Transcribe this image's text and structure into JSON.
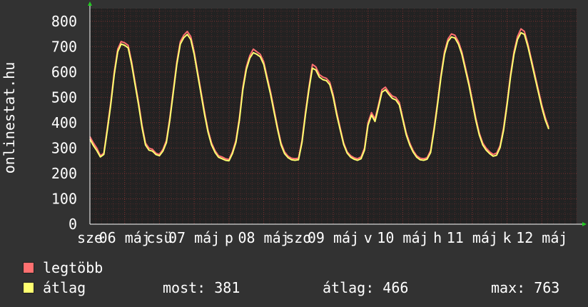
{
  "colors": {
    "background": "#323232",
    "plot_background": "#222222",
    "grid_major": "#7a3030",
    "grid_minor": "#4d2a2a",
    "text": "#ffffff",
    "max_series": "#ff7070",
    "avg_series": "#ffff70"
  },
  "chart_data": {
    "type": "line",
    "ylabel": "onlinestat.hu",
    "ylim": [
      0,
      850
    ],
    "yticks": [
      "0",
      "100",
      "200",
      "300",
      "400",
      "500",
      "600",
      "700",
      "800"
    ],
    "xlim": [
      0,
      7
    ],
    "xtick_labels": [
      {
        "x": 0.0,
        "label": "sze"
      },
      {
        "x": 0.5,
        "label": "06 máj"
      },
      {
        "x": 1.0,
        "label": "csü"
      },
      {
        "x": 1.5,
        "label": "07 máj"
      },
      {
        "x": 2.0,
        "label": "p"
      },
      {
        "x": 2.5,
        "label": "08 máj"
      },
      {
        "x": 3.0,
        "label": "szo"
      },
      {
        "x": 3.5,
        "label": "09 máj"
      },
      {
        "x": 4.0,
        "label": "v"
      },
      {
        "x": 4.5,
        "label": "10 máj"
      },
      {
        "x": 5.0,
        "label": "h"
      },
      {
        "x": 5.5,
        "label": "11 máj"
      },
      {
        "x": 6.0,
        "label": "k"
      },
      {
        "x": 6.5,
        "label": "12 máj"
      }
    ],
    "grid": true,
    "series": [
      {
        "name": "legtöbb",
        "color": "#ff7070",
        "points": [
          [
            0.0,
            345
          ],
          [
            0.05,
            320
          ],
          [
            0.1,
            300
          ],
          [
            0.15,
            270
          ],
          [
            0.2,
            280
          ],
          [
            0.25,
            380
          ],
          [
            0.3,
            480
          ],
          [
            0.35,
            600
          ],
          [
            0.4,
            690
          ],
          [
            0.45,
            720
          ],
          [
            0.5,
            715
          ],
          [
            0.55,
            705
          ],
          [
            0.6,
            640
          ],
          [
            0.65,
            560
          ],
          [
            0.7,
            480
          ],
          [
            0.75,
            390
          ],
          [
            0.8,
            320
          ],
          [
            0.85,
            300
          ],
          [
            0.9,
            295
          ],
          [
            0.95,
            280
          ],
          [
            1.0,
            275
          ],
          [
            1.05,
            295
          ],
          [
            1.1,
            330
          ],
          [
            1.15,
            420
          ],
          [
            1.2,
            530
          ],
          [
            1.25,
            640
          ],
          [
            1.3,
            720
          ],
          [
            1.35,
            745
          ],
          [
            1.4,
            760
          ],
          [
            1.45,
            740
          ],
          [
            1.5,
            680
          ],
          [
            1.55,
            600
          ],
          [
            1.6,
            520
          ],
          [
            1.65,
            440
          ],
          [
            1.7,
            370
          ],
          [
            1.75,
            320
          ],
          [
            1.8,
            290
          ],
          [
            1.85,
            270
          ],
          [
            1.9,
            265
          ],
          [
            1.95,
            258
          ],
          [
            2.0,
            255
          ],
          [
            2.05,
            285
          ],
          [
            2.1,
            330
          ],
          [
            2.15,
            420
          ],
          [
            2.2,
            540
          ],
          [
            2.25,
            620
          ],
          [
            2.3,
            665
          ],
          [
            2.35,
            690
          ],
          [
            2.4,
            680
          ],
          [
            2.45,
            670
          ],
          [
            2.5,
            640
          ],
          [
            2.55,
            580
          ],
          [
            2.6,
            520
          ],
          [
            2.65,
            450
          ],
          [
            2.7,
            380
          ],
          [
            2.75,
            320
          ],
          [
            2.8,
            285
          ],
          [
            2.85,
            268
          ],
          [
            2.9,
            260
          ],
          [
            2.95,
            258
          ],
          [
            3.0,
            260
          ],
          [
            3.05,
            330
          ],
          [
            3.1,
            440
          ],
          [
            3.15,
            540
          ],
          [
            3.2,
            630
          ],
          [
            3.25,
            620
          ],
          [
            3.3,
            590
          ],
          [
            3.35,
            580
          ],
          [
            3.4,
            575
          ],
          [
            3.45,
            560
          ],
          [
            3.5,
            510
          ],
          [
            3.55,
            440
          ],
          [
            3.6,
            380
          ],
          [
            3.65,
            320
          ],
          [
            3.7,
            285
          ],
          [
            3.75,
            270
          ],
          [
            3.8,
            262
          ],
          [
            3.85,
            258
          ],
          [
            3.9,
            265
          ],
          [
            3.95,
            300
          ],
          [
            4.0,
            400
          ],
          [
            4.05,
            440
          ],
          [
            4.1,
            415
          ],
          [
            4.15,
            470
          ],
          [
            4.2,
            530
          ],
          [
            4.25,
            540
          ],
          [
            4.3,
            520
          ],
          [
            4.35,
            505
          ],
          [
            4.4,
            500
          ],
          [
            4.45,
            480
          ],
          [
            4.5,
            420
          ],
          [
            4.55,
            360
          ],
          [
            4.6,
            320
          ],
          [
            4.65,
            290
          ],
          [
            4.7,
            270
          ],
          [
            4.75,
            260
          ],
          [
            4.8,
            258
          ],
          [
            4.85,
            262
          ],
          [
            4.9,
            290
          ],
          [
            4.95,
            380
          ],
          [
            5.0,
            480
          ],
          [
            5.05,
            590
          ],
          [
            5.1,
            680
          ],
          [
            5.15,
            730
          ],
          [
            5.2,
            750
          ],
          [
            5.25,
            745
          ],
          [
            5.3,
            720
          ],
          [
            5.35,
            680
          ],
          [
            5.4,
            620
          ],
          [
            5.45,
            560
          ],
          [
            5.5,
            490
          ],
          [
            5.55,
            420
          ],
          [
            5.6,
            360
          ],
          [
            5.65,
            320
          ],
          [
            5.7,
            300
          ],
          [
            5.75,
            285
          ],
          [
            5.8,
            275
          ],
          [
            5.85,
            280
          ],
          [
            5.9,
            310
          ],
          [
            5.95,
            380
          ],
          [
            6.0,
            480
          ],
          [
            6.05,
            590
          ],
          [
            6.1,
            680
          ],
          [
            6.15,
            740
          ],
          [
            6.2,
            770
          ],
          [
            6.25,
            760
          ],
          [
            6.3,
            710
          ],
          [
            6.35,
            650
          ],
          [
            6.4,
            590
          ],
          [
            6.45,
            530
          ],
          [
            6.5,
            470
          ],
          [
            6.55,
            420
          ],
          [
            6.6,
            381
          ]
        ]
      },
      {
        "name": "átlag",
        "color": "#ffff70",
        "points": [
          [
            0.0,
            335
          ],
          [
            0.05,
            310
          ],
          [
            0.1,
            290
          ],
          [
            0.15,
            265
          ],
          [
            0.2,
            275
          ],
          [
            0.25,
            370
          ],
          [
            0.3,
            470
          ],
          [
            0.35,
            590
          ],
          [
            0.4,
            680
          ],
          [
            0.45,
            710
          ],
          [
            0.5,
            705
          ],
          [
            0.55,
            695
          ],
          [
            0.6,
            630
          ],
          [
            0.65,
            550
          ],
          [
            0.7,
            470
          ],
          [
            0.75,
            380
          ],
          [
            0.8,
            312
          ],
          [
            0.85,
            292
          ],
          [
            0.9,
            288
          ],
          [
            0.95,
            274
          ],
          [
            1.0,
            270
          ],
          [
            1.05,
            288
          ],
          [
            1.1,
            322
          ],
          [
            1.15,
            410
          ],
          [
            1.2,
            520
          ],
          [
            1.25,
            630
          ],
          [
            1.3,
            710
          ],
          [
            1.35,
            735
          ],
          [
            1.4,
            748
          ],
          [
            1.45,
            728
          ],
          [
            1.5,
            670
          ],
          [
            1.55,
            590
          ],
          [
            1.6,
            510
          ],
          [
            1.65,
            430
          ],
          [
            1.7,
            362
          ],
          [
            1.75,
            312
          ],
          [
            1.8,
            283
          ],
          [
            1.85,
            264
          ],
          [
            1.9,
            258
          ],
          [
            1.95,
            252
          ],
          [
            2.0,
            250
          ],
          [
            2.05,
            278
          ],
          [
            2.1,
            322
          ],
          [
            2.15,
            410
          ],
          [
            2.2,
            530
          ],
          [
            2.25,
            610
          ],
          [
            2.3,
            655
          ],
          [
            2.35,
            676
          ],
          [
            2.4,
            670
          ],
          [
            2.45,
            660
          ],
          [
            2.5,
            630
          ],
          [
            2.55,
            570
          ],
          [
            2.6,
            510
          ],
          [
            2.65,
            440
          ],
          [
            2.7,
            372
          ],
          [
            2.75,
            312
          ],
          [
            2.8,
            278
          ],
          [
            2.85,
            262
          ],
          [
            2.9,
            254
          ],
          [
            2.95,
            252
          ],
          [
            3.0,
            254
          ],
          [
            3.05,
            322
          ],
          [
            3.1,
            430
          ],
          [
            3.15,
            530
          ],
          [
            3.2,
            615
          ],
          [
            3.25,
            608
          ],
          [
            3.3,
            580
          ],
          [
            3.35,
            570
          ],
          [
            3.4,
            566
          ],
          [
            3.45,
            550
          ],
          [
            3.5,
            500
          ],
          [
            3.55,
            430
          ],
          [
            3.6,
            372
          ],
          [
            3.65,
            314
          ],
          [
            3.7,
            280
          ],
          [
            3.75,
            264
          ],
          [
            3.8,
            256
          ],
          [
            3.85,
            252
          ],
          [
            3.9,
            258
          ],
          [
            3.95,
            292
          ],
          [
            4.0,
            390
          ],
          [
            4.05,
            430
          ],
          [
            4.1,
            405
          ],
          [
            4.15,
            460
          ],
          [
            4.2,
            520
          ],
          [
            4.25,
            530
          ],
          [
            4.3,
            512
          ],
          [
            4.35,
            496
          ],
          [
            4.4,
            490
          ],
          [
            4.45,
            470
          ],
          [
            4.5,
            412
          ],
          [
            4.55,
            352
          ],
          [
            4.6,
            312
          ],
          [
            4.65,
            284
          ],
          [
            4.7,
            264
          ],
          [
            4.75,
            254
          ],
          [
            4.8,
            252
          ],
          [
            4.85,
            256
          ],
          [
            4.9,
            282
          ],
          [
            4.95,
            370
          ],
          [
            5.0,
            470
          ],
          [
            5.05,
            580
          ],
          [
            5.1,
            670
          ],
          [
            5.15,
            720
          ],
          [
            5.2,
            738
          ],
          [
            5.25,
            734
          ],
          [
            5.3,
            710
          ],
          [
            5.35,
            670
          ],
          [
            5.4,
            610
          ],
          [
            5.45,
            550
          ],
          [
            5.5,
            480
          ],
          [
            5.55,
            410
          ],
          [
            5.6,
            352
          ],
          [
            5.65,
            312
          ],
          [
            5.7,
            292
          ],
          [
            5.75,
            278
          ],
          [
            5.8,
            268
          ],
          [
            5.85,
            272
          ],
          [
            5.9,
            302
          ],
          [
            5.95,
            370
          ],
          [
            6.0,
            470
          ],
          [
            6.05,
            580
          ],
          [
            6.1,
            670
          ],
          [
            6.15,
            728
          ],
          [
            6.2,
            755
          ],
          [
            6.25,
            748
          ],
          [
            6.3,
            700
          ],
          [
            6.35,
            640
          ],
          [
            6.4,
            580
          ],
          [
            6.45,
            520
          ],
          [
            6.5,
            460
          ],
          [
            6.55,
            410
          ],
          [
            6.6,
            375
          ]
        ]
      }
    ]
  },
  "legend": {
    "max_label": "legtöbb",
    "avg_label": "átlag"
  },
  "stats": {
    "current": "most: 381",
    "average": "átlag: 466",
    "max": "max: 763"
  }
}
